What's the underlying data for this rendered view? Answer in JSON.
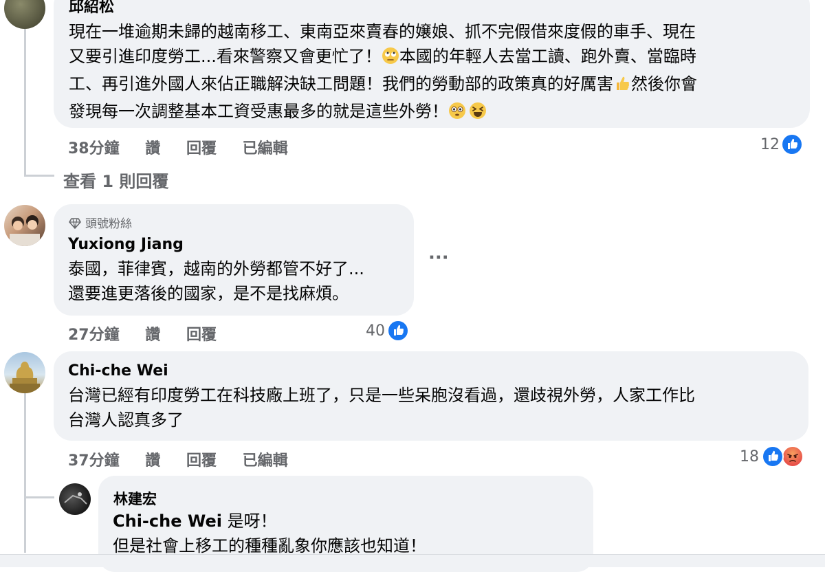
{
  "comment1": {
    "author": "邱紹松",
    "lines": [
      "現在一堆逾期未歸的越南移工、東南亞來賣春的嬢娘、抓不完假借來度假的車手、現在",
      "又要引進印度勞工...看來警察又會更忙了！",
      "本國的年輕人去當工讀、跑外賣、當臨時",
      "工、再引進外國人來佔正職解決缺工問題！我們的勞動部的政策真的好厲害",
      "然後你會",
      "發現每一次調整基本工資受惠最多的就是這些外勞！"
    ],
    "time": "38分鐘",
    "like_label": "讚",
    "reply_label": "回覆",
    "edited_label": "已編輯",
    "reaction_count": "12"
  },
  "view_replies": "查看 1 則回覆",
  "comment2": {
    "badge": "頭號粉絲",
    "author": "Yuxiong Jiang",
    "lines": [
      "泰國，菲律賓，越南的外勞都管不好了...",
      "還要進更落後的國家，是不是找麻煩。"
    ],
    "more": "···",
    "time": "27分鐘",
    "like_label": "讚",
    "reply_label": "回覆",
    "reaction_count": "40"
  },
  "comment3": {
    "author": "Chi-che Wei",
    "lines": [
      "台灣已經有印度勞工在科技廠上班了，只是一些呆胞沒看過，還歧視外勞，人家工作比",
      "台灣人認真多了"
    ],
    "time": "37分鐘",
    "like_label": "讚",
    "reply_label": "回覆",
    "edited_label": "已編輯",
    "reaction_count": "18"
  },
  "reply1": {
    "author": "林建宏",
    "mention": "Chi-che Wei",
    "line1_rest": " 是呀！",
    "line2": "但是社會上移工的種種亂象你應該也知道！"
  },
  "colors": {
    "bubble": "#f0f2f5",
    "meta": "#65676b",
    "like_blue": "#1877f2",
    "thread": "#ccd0d5"
  }
}
